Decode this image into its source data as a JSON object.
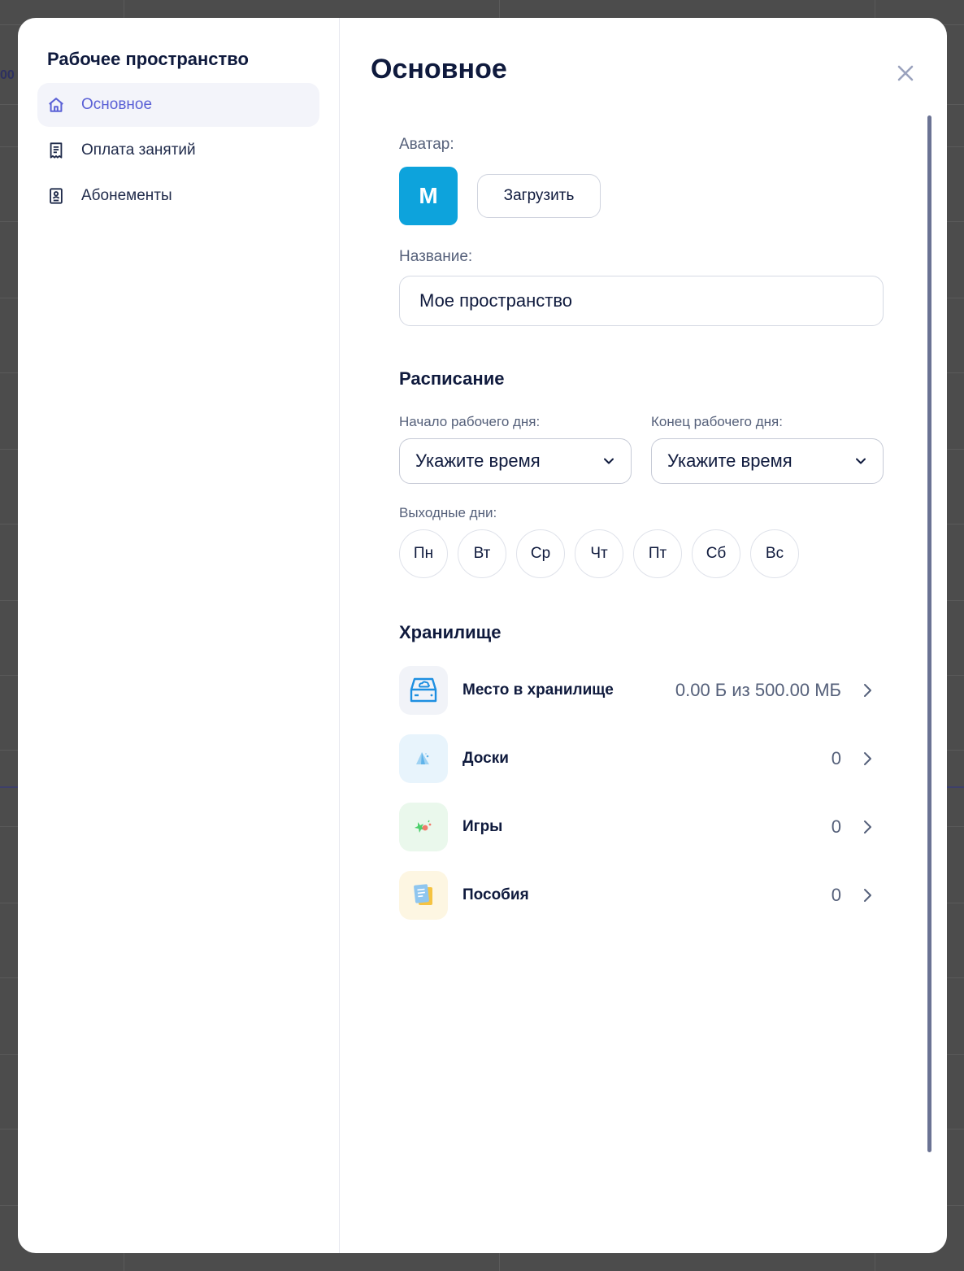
{
  "background": {
    "peek_text": "00"
  },
  "sidebar": {
    "title": "Рабочее пространство",
    "items": [
      {
        "label": "Основное",
        "icon": "home-icon",
        "active": true
      },
      {
        "label": "Оплата занятий",
        "icon": "receipt-icon",
        "active": false
      },
      {
        "label": "Абонементы",
        "icon": "membership-card-icon",
        "active": false
      }
    ]
  },
  "main": {
    "title": "Основное",
    "avatar": {
      "label": "Аватар:",
      "letter": "M",
      "color": "#0da3dc",
      "upload_label": "Загрузить"
    },
    "name": {
      "label": "Название:",
      "value": "Мое пространство"
    },
    "schedule": {
      "title": "Расписание",
      "start_label": "Начало рабочего дня:",
      "start_value": "Укажите время",
      "end_label": "Конец рабочего дня:",
      "end_value": "Укажите время",
      "weekend_label": "Выходные дни:",
      "days": [
        "Пн",
        "Вт",
        "Ср",
        "Чт",
        "Пт",
        "Сб",
        "Вс"
      ]
    },
    "storage": {
      "title": "Хранилище",
      "items": [
        {
          "name": "Место в хранилище",
          "value": "0.00 Б из 500.00 МБ",
          "icon": "storage-drive-icon"
        },
        {
          "name": "Доски",
          "value": "0",
          "icon": "boards-icon"
        },
        {
          "name": "Игры",
          "value": "0",
          "icon": "games-icon"
        },
        {
          "name": "Пособия",
          "value": "0",
          "icon": "materials-icon"
        }
      ]
    }
  },
  "colors": {
    "accent": "#5b61d6",
    "text": "#0f1a3d",
    "muted": "#55607a",
    "scrollbar": "#6b7394"
  }
}
